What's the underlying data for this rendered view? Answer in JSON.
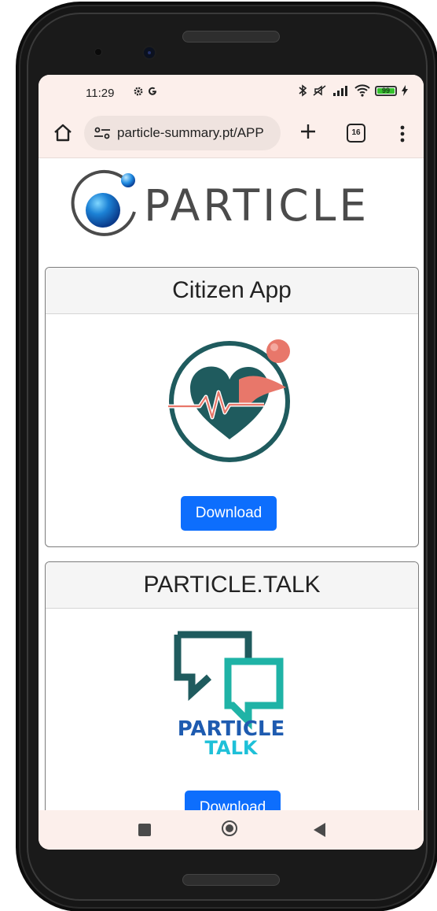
{
  "status_bar": {
    "time": "11:29",
    "left_icons": [
      "gear-icon",
      "google-icon"
    ],
    "right_icons": [
      "bluetooth-icon",
      "mute-icon",
      "signal-icon",
      "wifi-icon",
      "battery-icon",
      "charging-icon"
    ],
    "battery_level": "99"
  },
  "browser": {
    "url": "particle-summary.pt/APP",
    "tab_count": "16"
  },
  "logo": {
    "text": "PARTICLE"
  },
  "cards": [
    {
      "title": "Citizen App",
      "button_label": "Download"
    },
    {
      "title": "PARTICLE.TALK",
      "button_label": "Download",
      "icon_text_line1": "PARTICLE",
      "icon_text_line2": "TALK"
    }
  ],
  "colors": {
    "accent": "#0d6efd",
    "browser_chrome": "#fcefeb",
    "heart_teal": "#1f5b5e",
    "coral": "#e8776a",
    "talk_blue": "#1e5bb0",
    "talk_cyan": "#1ec0d8"
  }
}
